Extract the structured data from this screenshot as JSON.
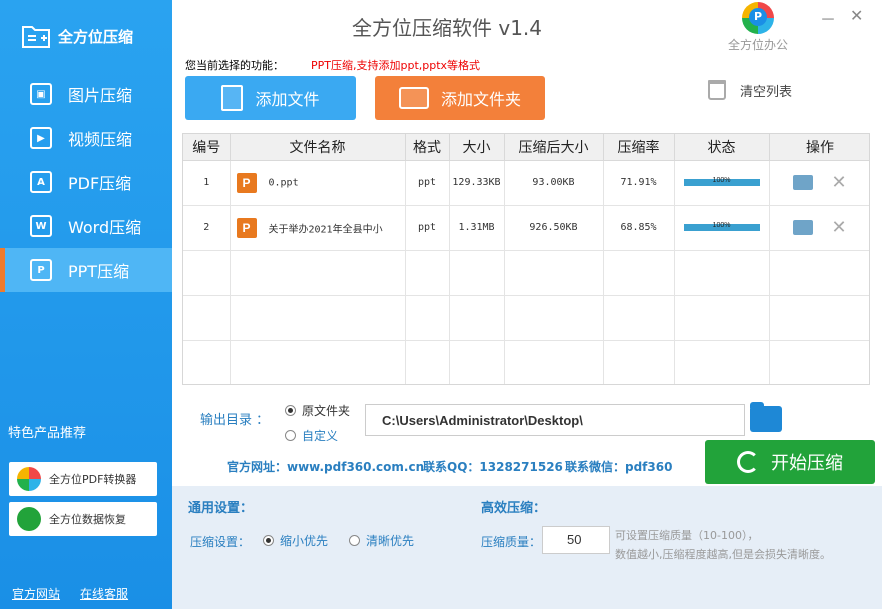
{
  "app": {
    "logo_text": "全方位压缩",
    "title": "全方位压缩软件 v1.4",
    "brand_text": "全方位办公",
    "minimize": "－",
    "close": "✕"
  },
  "sidebar": {
    "items": [
      {
        "label": "图片压缩",
        "icon": "image-icon",
        "glyph": "▣"
      },
      {
        "label": "视频压缩",
        "icon": "video-icon",
        "glyph": "▶"
      },
      {
        "label": "PDF压缩",
        "icon": "pdf-icon",
        "glyph": "A"
      },
      {
        "label": "Word压缩",
        "icon": "word-icon",
        "glyph": "W"
      },
      {
        "label": "PPT压缩",
        "icon": "ppt-icon",
        "glyph": "P"
      }
    ],
    "active_index": 4,
    "recommend_title": "特色产品推荐",
    "products": [
      {
        "label": "全方位PDF转换器"
      },
      {
        "label": "全方位数据恢复"
      }
    ],
    "footer": {
      "website": "官方网站",
      "service": "在线客服"
    }
  },
  "toolbar": {
    "func_label": "您当前选择的功能：",
    "func_value": "PPT压缩,支持添加ppt,pptx等格式",
    "add_file": "添加文件",
    "add_folder": "添加文件夹",
    "clear_list": "清空列表"
  },
  "table": {
    "headers": [
      "编号",
      "文件名称",
      "格式",
      "大小",
      "压缩后大小",
      "压缩率",
      "状态",
      "操作"
    ],
    "rows": [
      {
        "no": "1",
        "name": "0.ppt",
        "format": "ppt",
        "size": "129.33KB",
        "compressed": "93.00KB",
        "ratio": "71.91%",
        "status": "100%",
        "progress": 1.0
      },
      {
        "no": "2",
        "name": "关于举办2021年全县中小",
        "format": "ppt",
        "size": "1.31MB",
        "compressed": "926.50KB",
        "ratio": "68.85%",
        "status": "100%",
        "progress": 1.0
      }
    ],
    "empty_rows": 3
  },
  "output": {
    "label": "输出目录 ：",
    "option_source": "原文件夹",
    "option_custom": "自定义",
    "selected": "原文件夹",
    "path": "C:\\Users\\Administrator\\Desktop\\"
  },
  "info": {
    "website": "官方网址：www.pdf360.com.cn",
    "qq": "联系QQ：1328271526",
    "wechat": "联系微信：pdf360"
  },
  "start_button": "开始压缩",
  "settings": {
    "general_title": "通用设置：",
    "compress_label": "压缩设置：",
    "opt_small": "缩小优先",
    "opt_clear": "清晰优先",
    "selected": "缩小优先",
    "efficient_title": "高效压缩：",
    "quality_label": "压缩质量：",
    "quality_value": "50",
    "hint_line1": "可设置压缩质量（10-100），",
    "hint_line2": "数值越小,压缩程度越高,但是会损失清晰度。"
  }
}
